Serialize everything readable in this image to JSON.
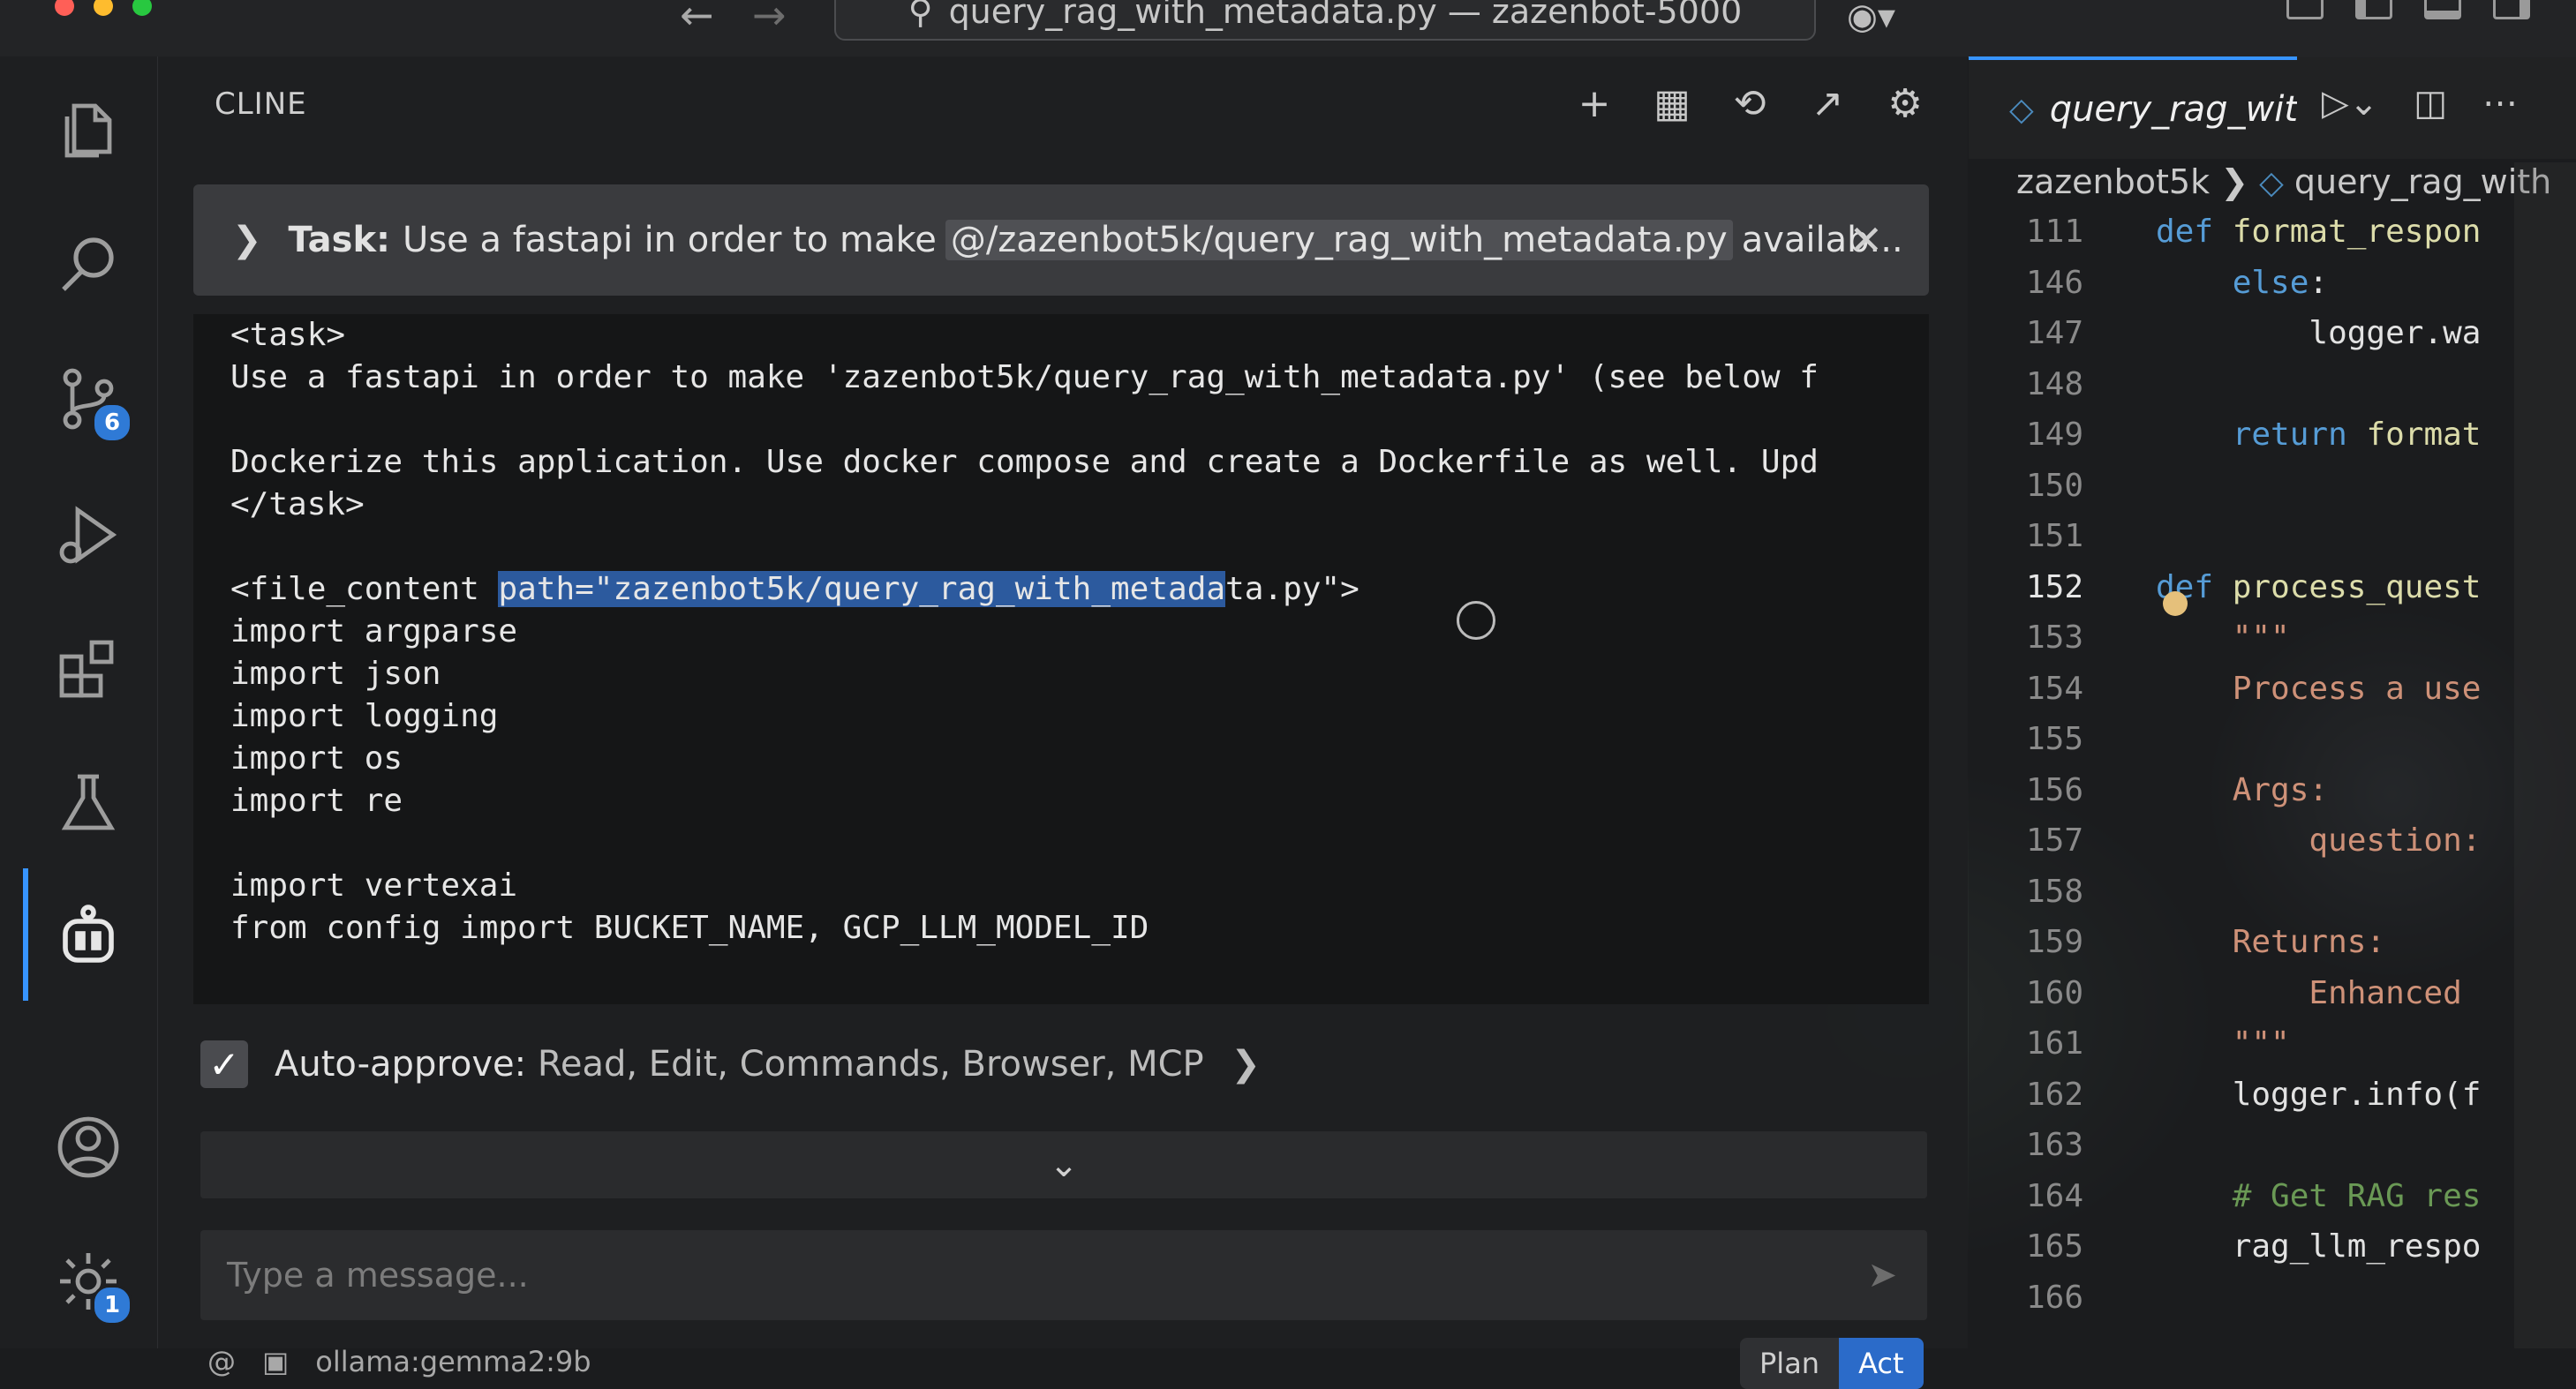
{
  "window": {
    "title": "query_rag_with_metadata.py — zazenbot-5000",
    "traffic_colors": [
      "#ff5f57",
      "#febc2e",
      "#28c840"
    ]
  },
  "activity_bar": {
    "scm_badge": "6",
    "settings_badge": "1",
    "items": [
      "explorer-icon",
      "search-icon",
      "source-control-icon",
      "run-debug-icon",
      "extensions-icon",
      "testing-icon",
      "cline-robot-icon",
      "account-icon",
      "gear-icon"
    ]
  },
  "cline": {
    "panel_title": "CLINE",
    "task": {
      "label": "Task:",
      "text_before": "Use a fastapi in order to make",
      "mention": "@/zazenbot5k/query_rag_with_metadata.py",
      "text_after": "availab..."
    },
    "code_lines": [
      "<task>",
      "Use a fastapi in order to make 'zazenbot5k/query_rag_with_metadata.py' (see below f",
      "",
      "Dockerize this application. Use docker compose and create a Dockerfile as well. Upd",
      "</task>",
      "",
      "<file_content ",
      "import argparse",
      "import json",
      "import logging",
      "import os",
      "import re",
      "",
      "import vertexai",
      "from config import BUCKET_NAME, GCP_LLM_MODEL_ID"
    ],
    "file_content_selected": "path=\"zazenbot5k/query_rag_with_metada",
    "file_content_rest": "ta.py\">",
    "auto_approve": {
      "label": "Auto-approve:",
      "values": "Read, Edit, Commands, Browser, MCP"
    },
    "input_placeholder": "Type a message...",
    "at_symbol": "@",
    "model": "ollama:gemma2:9b",
    "mode_plan": "Plan",
    "mode_act": "Act"
  },
  "editor": {
    "tab_label": "query_rag_witl",
    "breadcrumb_folder": "zazenbot5k",
    "breadcrumb_file": "query_rag_with",
    "current_line": "152",
    "lines": [
      {
        "n": "111",
        "code": "def format_respon",
        "kind": "def"
      },
      {
        "n": "146",
        "code": "    else:",
        "kind": "kw"
      },
      {
        "n": "147",
        "code": "        logger.wa",
        "kind": "plain"
      },
      {
        "n": "148",
        "code": "",
        "kind": "plain"
      },
      {
        "n": "149",
        "code": "    return format",
        "kind": "ret"
      },
      {
        "n": "150",
        "code": "",
        "kind": "plain"
      },
      {
        "n": "151",
        "code": "",
        "kind": "plain"
      },
      {
        "n": "152",
        "code": "def process_quest",
        "kind": "def"
      },
      {
        "n": "153",
        "code": "    \"\"\"",
        "kind": "str"
      },
      {
        "n": "154",
        "code": "    Process a use",
        "kind": "str"
      },
      {
        "n": "155",
        "code": "",
        "kind": "str"
      },
      {
        "n": "156",
        "code": "    Args:",
        "kind": "str"
      },
      {
        "n": "157",
        "code": "        question:",
        "kind": "str"
      },
      {
        "n": "158",
        "code": "",
        "kind": "str"
      },
      {
        "n": "159",
        "code": "    Returns:",
        "kind": "str"
      },
      {
        "n": "160",
        "code": "        Enhanced",
        "kind": "str"
      },
      {
        "n": "161",
        "code": "    \"\"\"",
        "kind": "str"
      },
      {
        "n": "162",
        "code": "    logger.info(f",
        "kind": "plain"
      },
      {
        "n": "163",
        "code": "",
        "kind": "plain"
      },
      {
        "n": "164",
        "code": "    # Get RAG res",
        "kind": "cm"
      },
      {
        "n": "165",
        "code": "    rag_llm_respo",
        "kind": "plain"
      },
      {
        "n": "166",
        "code": "",
        "kind": "plain"
      }
    ]
  }
}
